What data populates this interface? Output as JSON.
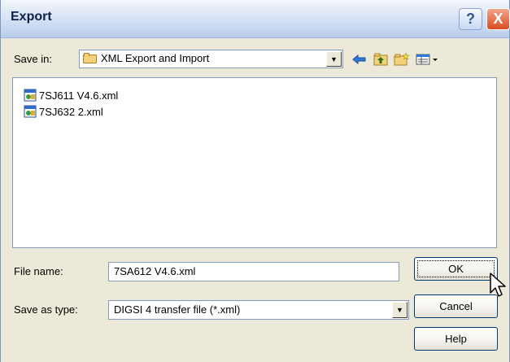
{
  "window": {
    "title": "Export"
  },
  "title_buttons": {
    "help": "?",
    "close": "X"
  },
  "save_in": {
    "label": "Save in:",
    "value": "XML Export and Import",
    "icon": "folder-icon"
  },
  "toolbar_icons": [
    "back-arrow-icon",
    "up-folder-icon",
    "new-folder-icon",
    "view-menu-icon"
  ],
  "files": [
    {
      "name": "7SJ611 V4.6.xml",
      "icon": "xml-file-icon"
    },
    {
      "name": "7SJ632 2.xml",
      "icon": "xml-file-icon"
    }
  ],
  "file_name": {
    "label": "File name:",
    "value": "7SA612 V4.6.xml"
  },
  "save_as_type": {
    "label": "Save as type:",
    "value": "DIGSI 4 transfer file (*.xml)"
  },
  "buttons": {
    "ok": "OK",
    "cancel": "Cancel",
    "help": "Help"
  },
  "colors": {
    "dialog_bg": "#ece9d8",
    "title_text": "#10204a",
    "close_red": "#d94b22",
    "field_border": "#7f9db9"
  }
}
